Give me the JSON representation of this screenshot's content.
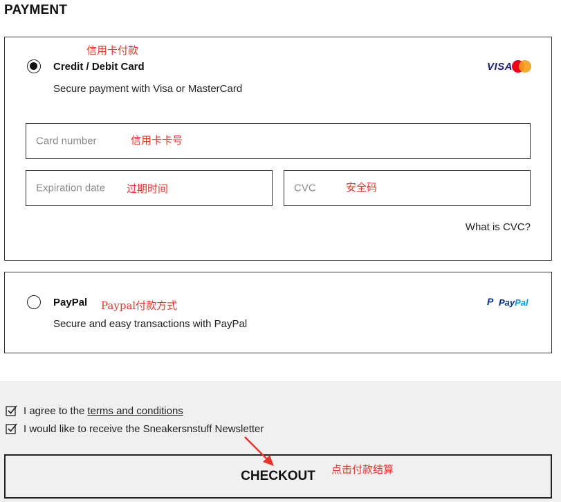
{
  "page_title": "PAYMENT",
  "credit_card": {
    "annotation": "信用卡付款",
    "title": "Credit / Debit Card",
    "description": "Secure payment with Visa or MasterCard",
    "brand_visa": "VISA",
    "selected": true,
    "card_number": {
      "placeholder": "Card number",
      "annotation": "信用卡卡号"
    },
    "expiration": {
      "placeholder": "Expiration date",
      "annotation": "过期时间"
    },
    "cvc": {
      "placeholder": "CVC",
      "annotation": "安全码"
    },
    "what_is_cvc": "What is CVC?"
  },
  "paypal": {
    "title": "PayPal",
    "annotation": "Paypal付款方式",
    "description": "Secure and easy transactions with PayPal",
    "brand_pay": "Pay",
    "brand_pal": "Pal",
    "selected": false
  },
  "agreements": {
    "terms_prefix": "I agree to the",
    "terms_link": "terms and conditions",
    "newsletter": "I would like to receive the Sneakersnstuff Newsletter",
    "terms_checked": true,
    "newsletter_checked": true
  },
  "checkout": {
    "label": "CHECKOUT",
    "annotation": "点击付款结算"
  },
  "colors": {
    "annotation": "#e8352b",
    "visa_blue": "#1a1f71",
    "mc_red": "#eb001b",
    "mc_orange": "#f79e1b",
    "paypal_dark": "#003087",
    "paypal_light": "#009cde",
    "footer_bg": "#f0f0f0"
  }
}
